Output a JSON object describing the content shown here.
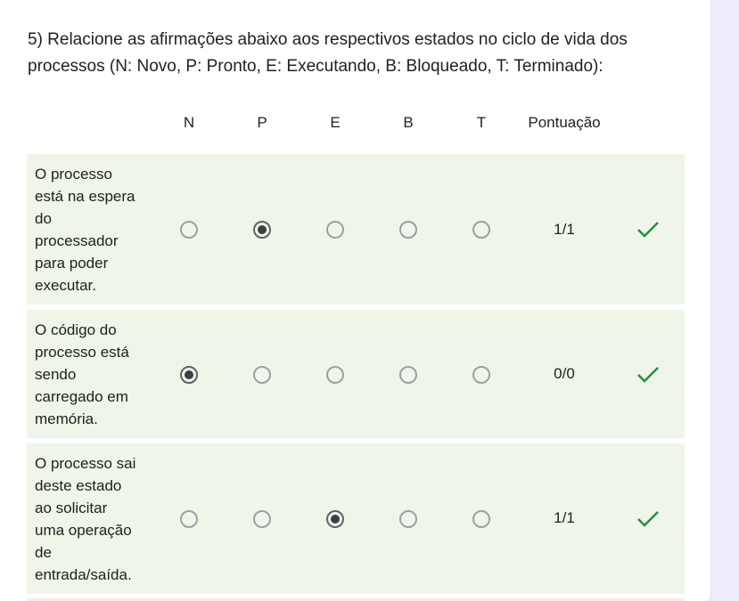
{
  "question": {
    "text": "5) Relacione as afirmações abaixo aos respectivos estados no ciclo de vida dos processos (N: Novo, P: Pronto, E: Executando, B: Bloqueado, T: Terminado):"
  },
  "columns": [
    "N",
    "P",
    "E",
    "B",
    "T"
  ],
  "score_header": "Pontuação",
  "rows": [
    {
      "label_lines": [
        "O processo",
        "está na espera",
        "do",
        "processador",
        "para poder",
        "executar."
      ],
      "selected": "P",
      "score": "1/1",
      "correct_icon": "check-icon"
    },
    {
      "label_lines": [
        "O código do",
        "processo está",
        "sendo",
        "carregado em",
        "memória."
      ],
      "selected": "N",
      "score": "0/0",
      "correct_icon": "check-icon"
    },
    {
      "label_lines": [
        "O processo sai",
        "deste estado",
        "ao solicitar",
        "uma operação",
        "de",
        "entrada/saída."
      ],
      "selected": "E",
      "score": "1/1",
      "correct_icon": "check-icon"
    }
  ],
  "colors": {
    "row_background": "#eff5e8",
    "check": "#1e8e3e",
    "page_background": "#f0ebf8"
  }
}
